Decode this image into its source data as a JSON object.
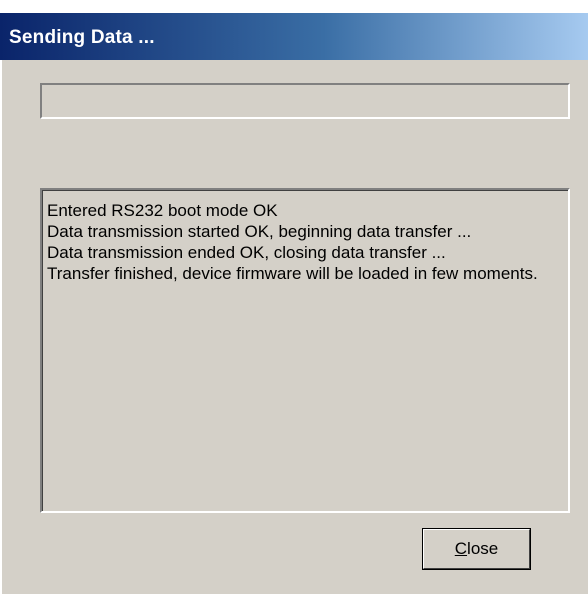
{
  "window": {
    "title": "Sending Data ..."
  },
  "progress": {
    "fraction": 0
  },
  "log": {
    "lines": [
      "Entered RS232 boot mode OK",
      "Data transmission started OK, beginning data transfer ...",
      "Data transmission ended OK, closing data transfer ...",
      "Transfer finished, device firmware will be loaded in few moments."
    ]
  },
  "buttons": {
    "close_mnemonic": "C",
    "close_rest": "lose"
  },
  "colors": {
    "title_gradient_start": "#0a246a",
    "title_gradient_end": "#a6caf0",
    "dialog_background": "#d4d0c8"
  }
}
